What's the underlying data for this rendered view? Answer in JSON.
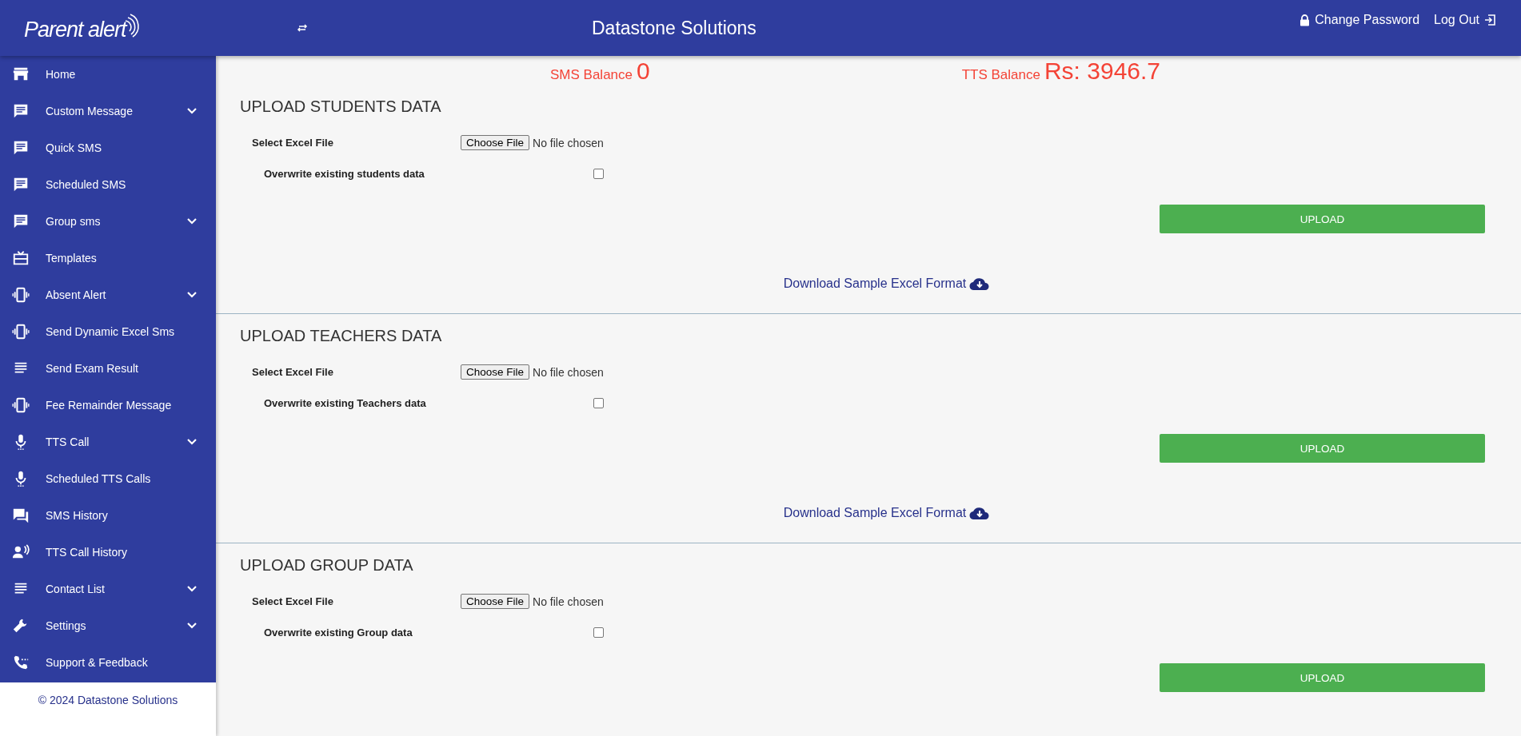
{
  "header": {
    "logo": "Parent alert",
    "title": "Datastone Solutions",
    "change_password": "Change Password",
    "logout": "Log Out"
  },
  "sidebar": {
    "items": [
      {
        "label": "Home",
        "has_submenu": false
      },
      {
        "label": "Custom Message",
        "has_submenu": true
      },
      {
        "label": "Quick SMS",
        "has_submenu": false
      },
      {
        "label": "Scheduled SMS",
        "has_submenu": false
      },
      {
        "label": "Group sms",
        "has_submenu": true
      },
      {
        "label": "Templates",
        "has_submenu": false
      },
      {
        "label": "Absent Alert",
        "has_submenu": true
      },
      {
        "label": "Send Dynamic Excel Sms",
        "has_submenu": false
      },
      {
        "label": "Send Exam Result",
        "has_submenu": false
      },
      {
        "label": "Fee Remainder Message",
        "has_submenu": false
      },
      {
        "label": "TTS Call",
        "has_submenu": true
      },
      {
        "label": "Scheduled TTS Calls",
        "has_submenu": false
      },
      {
        "label": "SMS History",
        "has_submenu": false
      },
      {
        "label": "TTS Call History",
        "has_submenu": false
      },
      {
        "label": "Contact List",
        "has_submenu": true
      },
      {
        "label": "Settings",
        "has_submenu": true
      },
      {
        "label": "Support & Feedback",
        "has_submenu": false
      }
    ],
    "footer": "© 2024 Datastone Solutions"
  },
  "balances": [
    {
      "label": "SMS Balance",
      "value": "0"
    },
    {
      "label": "TTS Balance",
      "value": "Rs: 3946.7"
    }
  ],
  "sections": [
    {
      "title": "UPLOAD STUDENTS DATA",
      "file_label": "Select Excel File",
      "file_button": "Choose File",
      "file_status": "No file chosen",
      "overwrite_label": "Overwrite existing students data",
      "checked": false,
      "upload": "UPLOAD",
      "download": "Download Sample Excel Format"
    },
    {
      "title": "UPLOAD TEACHERS DATA",
      "file_label": "Select Excel File",
      "file_button": "Choose File",
      "file_status": "No file chosen",
      "overwrite_label": "Overwrite existing Teachers data",
      "checked": false,
      "upload": "UPLOAD",
      "download": "Download Sample Excel Format"
    },
    {
      "title": "UPLOAD GROUP DATA",
      "file_label": "Select Excel File",
      "file_button": "Choose File",
      "file_status": "No file chosen",
      "overwrite_label": "Overwrite existing Group data",
      "checked": false,
      "upload": "UPLOAD"
    }
  ]
}
